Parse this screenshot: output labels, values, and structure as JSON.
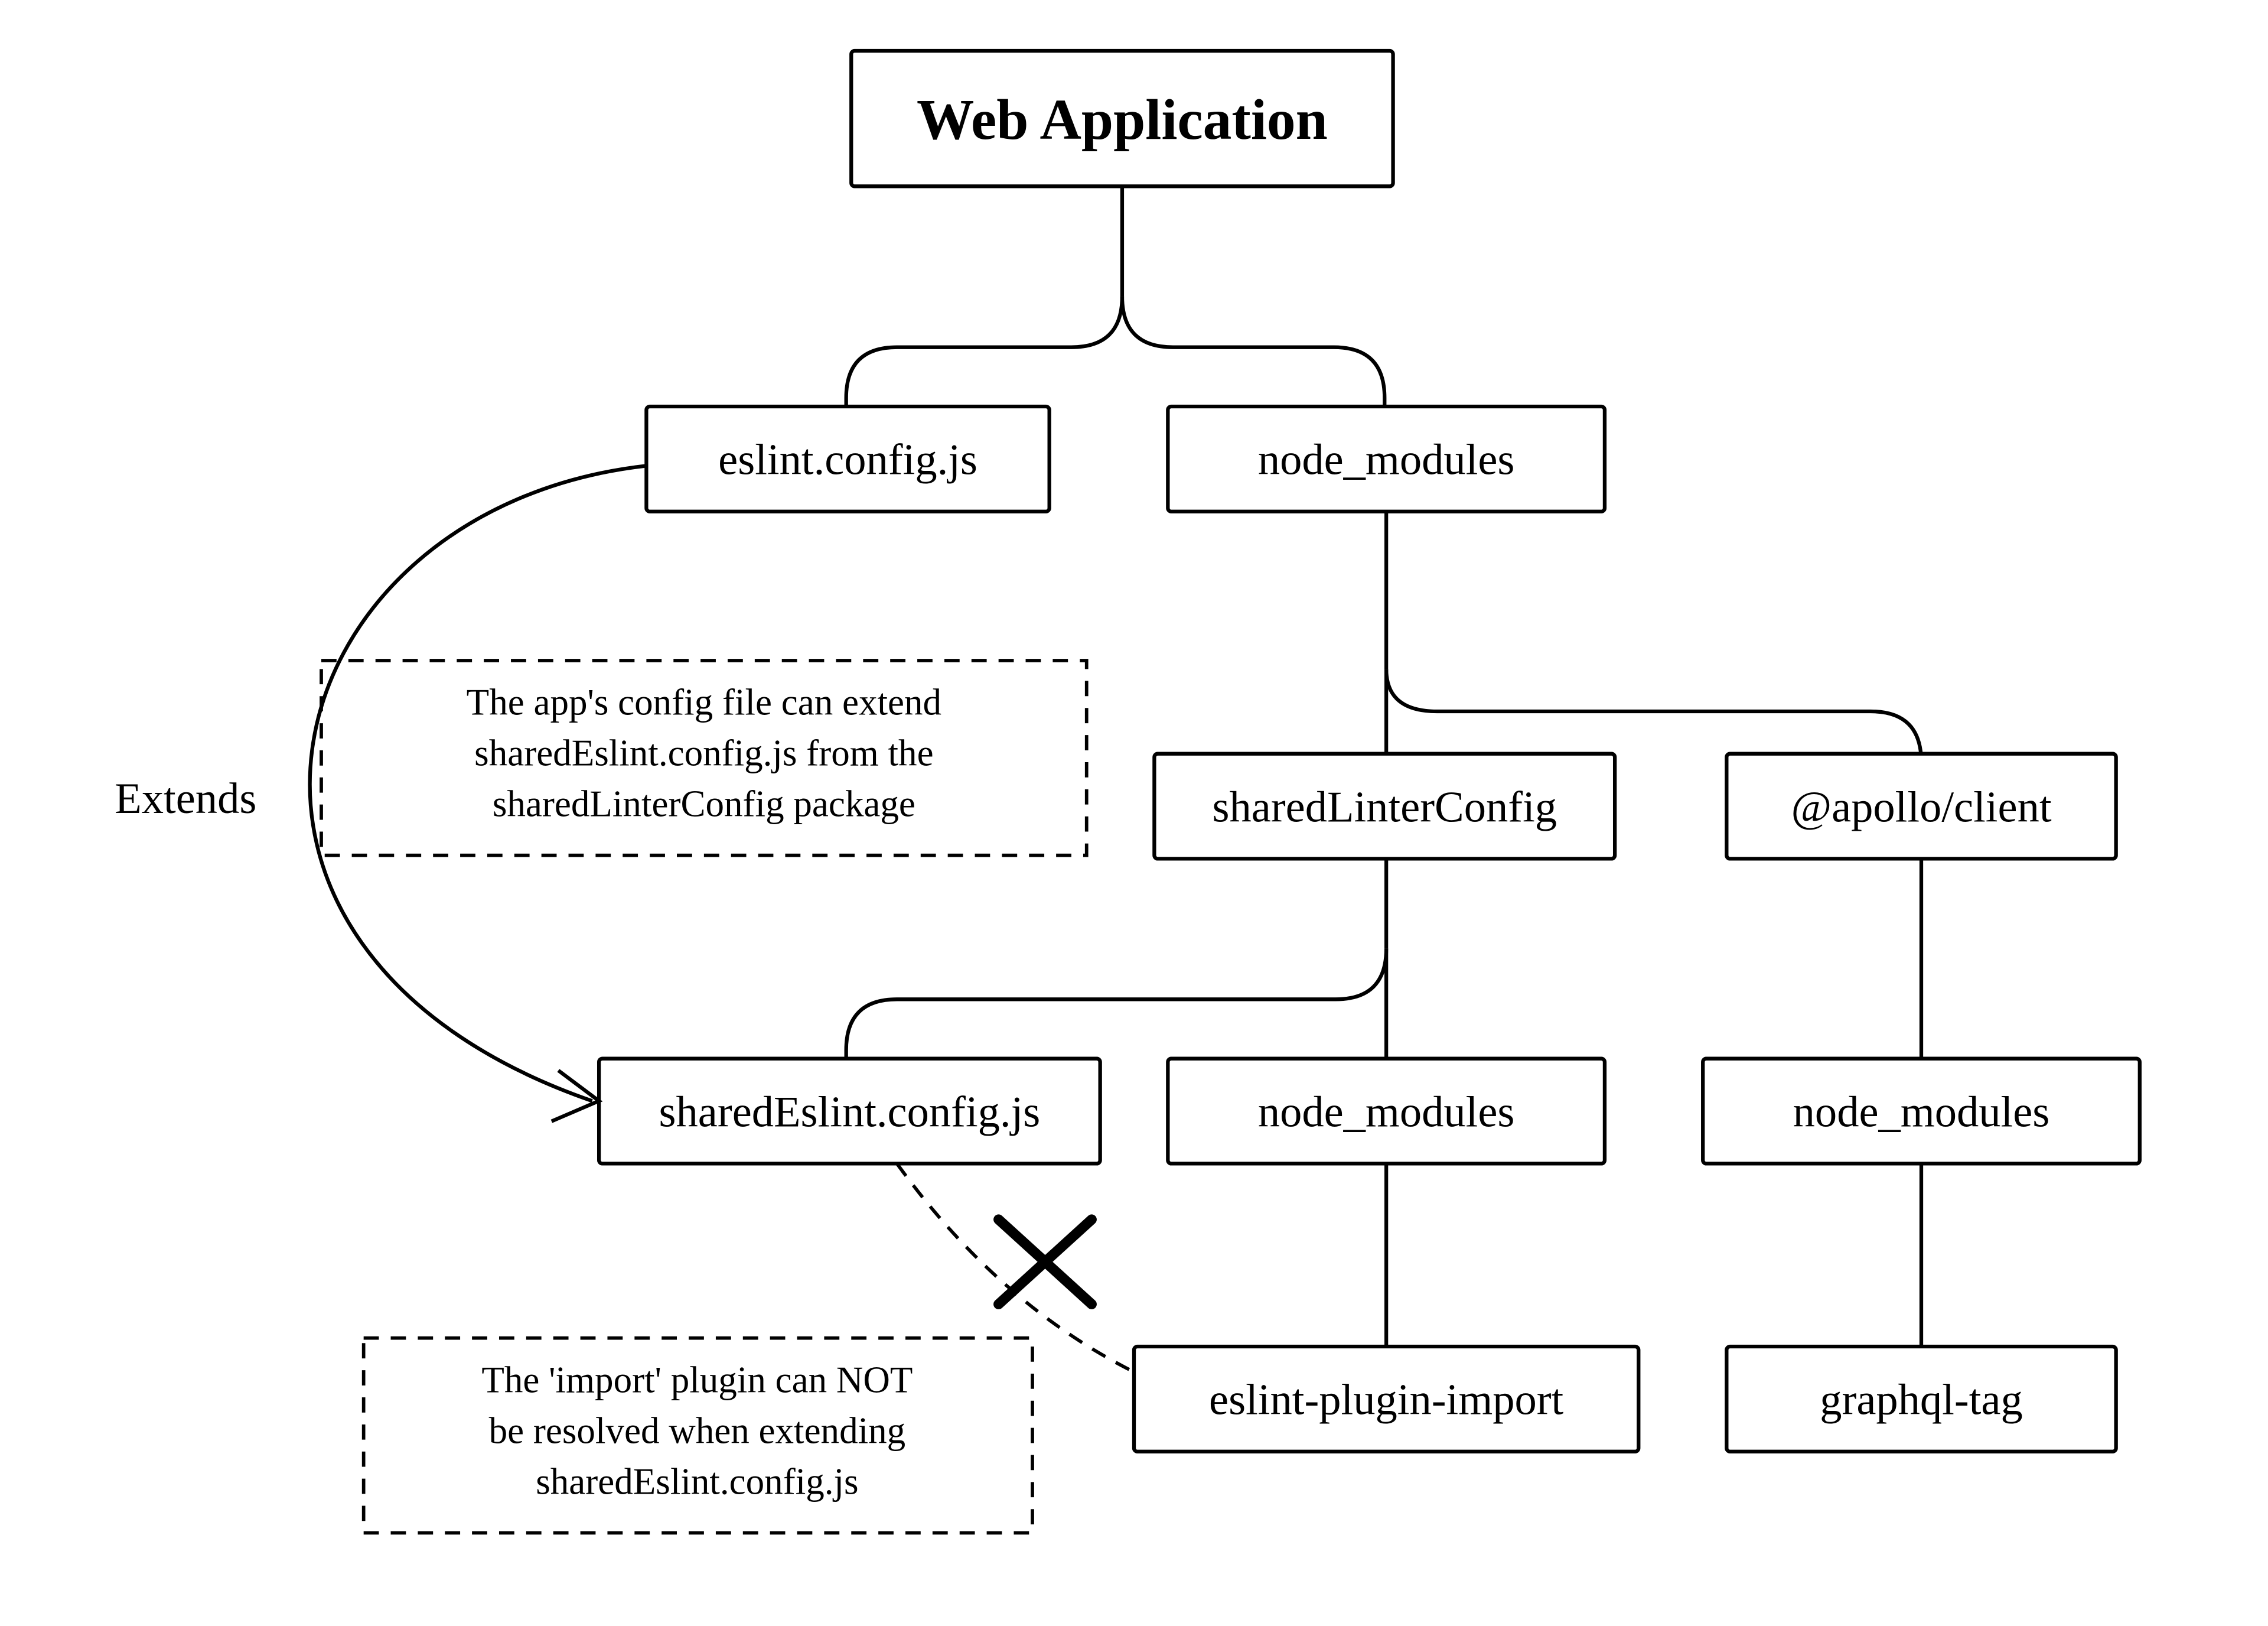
{
  "nodes": {
    "root": "Web Application",
    "eslint_config": "eslint.config.js",
    "node_modules_1": "node_modules",
    "shared_linter_config": "sharedLinterConfig",
    "apollo_client": "@apollo/client",
    "shared_eslint_config": "sharedEslint.config.js",
    "node_modules_2": "node_modules",
    "node_modules_3": "node_modules",
    "eslint_plugin_import": "eslint-plugin-import",
    "graphql_tag": "graphql-tag"
  },
  "edge_labels": {
    "extends": "Extends"
  },
  "notes": {
    "note1_l1": "The app's config file can extend",
    "note1_l2": "sharedEslint.config.js from the",
    "note1_l3": "sharedLinterConfig package",
    "note2_l1": "The 'import' plugin can NOT",
    "note2_l2": "be resolved when extending",
    "note2_l3": "sharedEslint.config.js"
  }
}
